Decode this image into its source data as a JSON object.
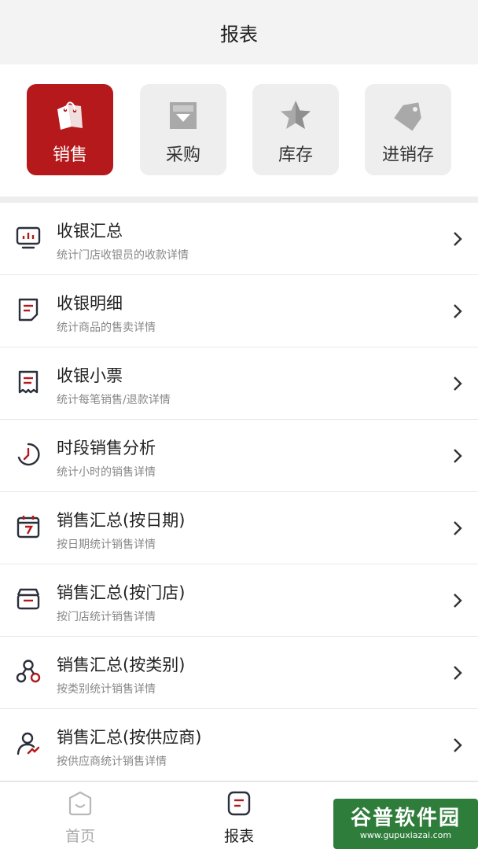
{
  "header": {
    "title": "报表"
  },
  "categories": [
    {
      "label": "销售",
      "icon": "shopping-tags-icon",
      "active": true
    },
    {
      "label": "采购",
      "icon": "download-box-icon",
      "active": false
    },
    {
      "label": "库存",
      "icon": "star-icon",
      "active": false
    },
    {
      "label": "进销存",
      "icon": "price-tag-icon",
      "active": false
    }
  ],
  "reports": [
    {
      "title": "收银汇总",
      "subtitle": "统计门店收银员的收款详情",
      "icon": "monitor-chart-icon"
    },
    {
      "title": "收银明细",
      "subtitle": "统计商品的售卖详情",
      "icon": "document-icon"
    },
    {
      "title": "收银小票",
      "subtitle": "统计每笔销售/退款详情",
      "icon": "receipt-icon"
    },
    {
      "title": "时段销售分析",
      "subtitle": "统计小时的销售详情",
      "icon": "clock-icon"
    },
    {
      "title": "销售汇总(按日期)",
      "subtitle": "按日期统计销售详情",
      "icon": "calendar-icon"
    },
    {
      "title": "销售汇总(按门店)",
      "subtitle": "按门店统计销售详情",
      "icon": "store-icon"
    },
    {
      "title": "销售汇总(按类别)",
      "subtitle": "按类别统计销售详情",
      "icon": "category-nodes-icon"
    },
    {
      "title": "销售汇总(按供应商)",
      "subtitle": "按供应商统计销售详情",
      "icon": "supplier-user-icon"
    }
  ],
  "tabbar": [
    {
      "label": "首页",
      "icon": "home-icon",
      "active": false
    },
    {
      "label": "报表",
      "icon": "report-icon",
      "active": true
    }
  ],
  "watermark": {
    "big": "谷普软件园",
    "small": "www.gupuxiazai.com"
  },
  "colors": {
    "accent": "#b5191b",
    "inactive_tile": "#eeeeee",
    "icon_dark": "#2b2f3a"
  }
}
